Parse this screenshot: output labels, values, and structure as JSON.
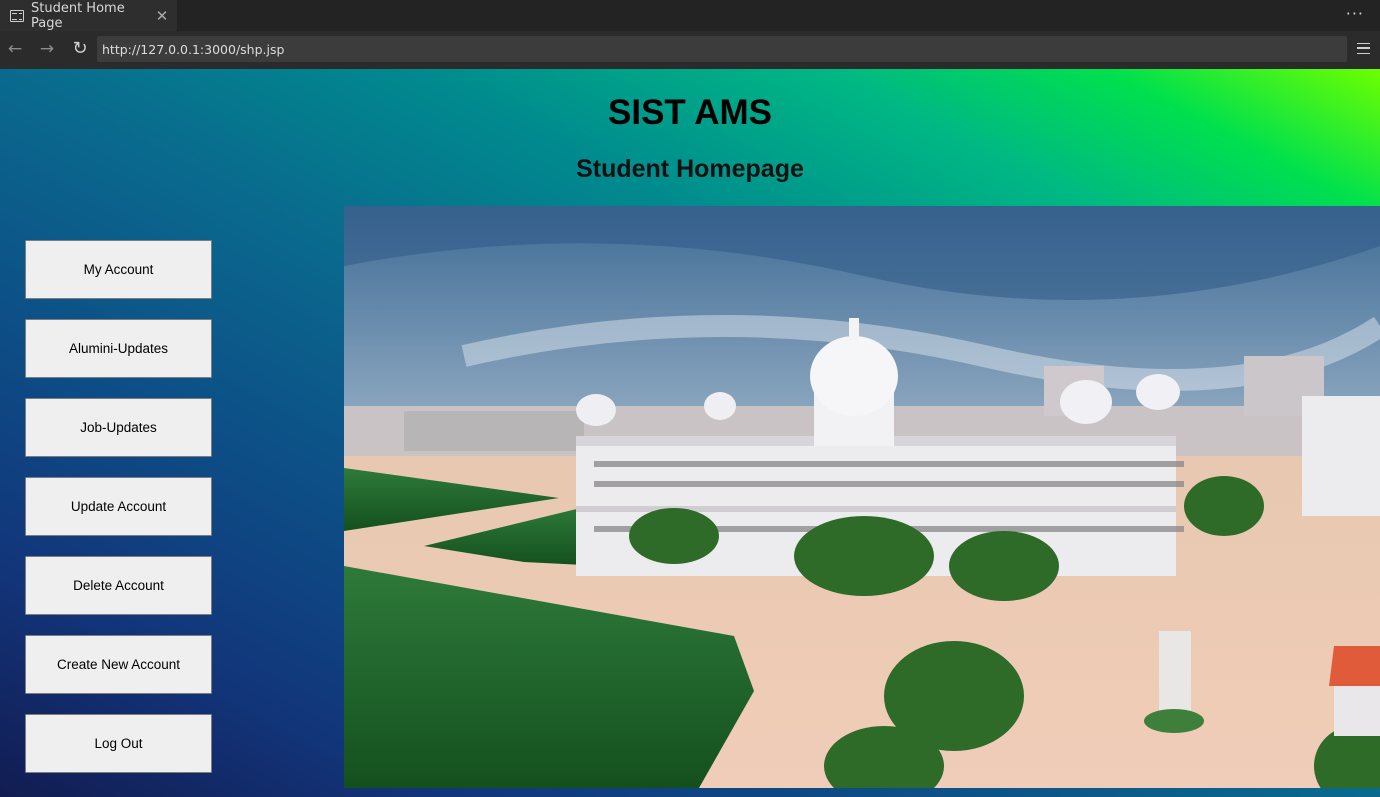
{
  "browser": {
    "tab_title": "Student Home Page",
    "tab_close_icon": "close-icon",
    "menu_icon": "more-icon",
    "url": "http://127.0.0.1:3000/shp.jsp"
  },
  "header": {
    "title": "SIST AMS",
    "subtitle": "Student Homepage"
  },
  "sidebar": {
    "buttons": [
      {
        "label": "My Account"
      },
      {
        "label": "Alumini-Updates"
      },
      {
        "label": "Job-Updates"
      },
      {
        "label": "Update Account"
      },
      {
        "label": "Delete Account"
      },
      {
        "label": "Create New Account"
      },
      {
        "label": "Log Out"
      }
    ]
  },
  "colors": {
    "gradient_top_right": "#6cff00",
    "gradient_bottom_left": "#121c52",
    "button_bg": "#efefef"
  }
}
